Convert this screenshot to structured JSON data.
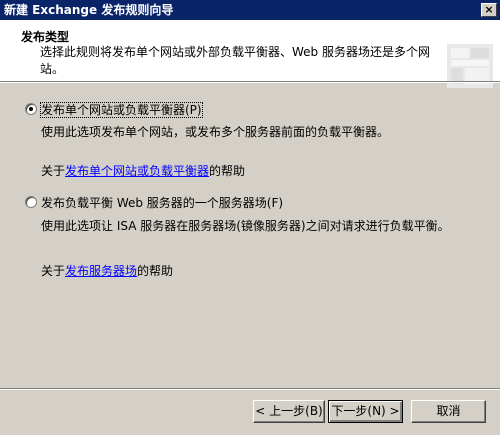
{
  "window": {
    "title": "新建 Exchange 发布规则向导",
    "close_glyph": "×"
  },
  "header": {
    "title": "发布类型",
    "description": "选择此规则将发布单个网站或外部负载平衡器、Web 服务器场还是多个网站。"
  },
  "options": [
    {
      "label": "发布单个网站或负载平衡器(P)",
      "selected": true,
      "description": "使用此选项发布单个网站，或发布多个服务器前面的负载平衡器。",
      "help_prefix": "关于",
      "help_link": "发布单个网站或负载平衡器",
      "help_suffix": "的帮助"
    },
    {
      "label": "发布负载平衡 Web 服务器的一个服务器场(F)",
      "selected": false,
      "description": "使用此选项让 ISA 服务器在服务器场(镜像服务器)之间对请求进行负载平衡。",
      "help_prefix": "关于",
      "help_link": "发布服务器场",
      "help_suffix": "的帮助"
    }
  ],
  "buttons": {
    "back": "< 上一步(B)",
    "next": "下一步(N) >",
    "cancel": "取消"
  }
}
